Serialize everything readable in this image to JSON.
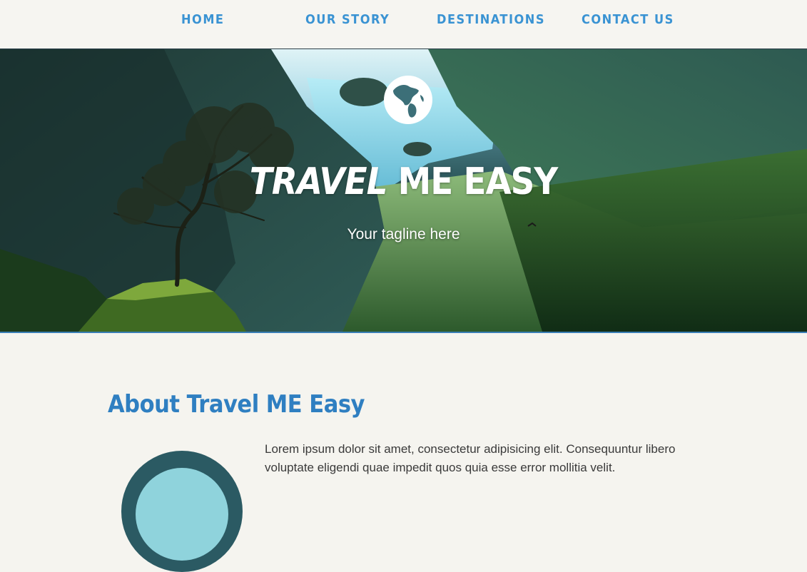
{
  "nav": {
    "items": [
      {
        "label": "HOME"
      },
      {
        "label": "OUR STORY"
      },
      {
        "label": "DESTINATIONS"
      },
      {
        "label": "CONTACT US"
      }
    ]
  },
  "hero": {
    "title_accent": "TRAVEL",
    "title_rest": " ME EASY",
    "tagline": "Your tagline here",
    "logo_icon": "globe-icon"
  },
  "about": {
    "title": "About Travel ME Easy",
    "text": "Lorem ipsum dolor sit amet, consectetur adipisicing elit. Consequuntur libero voluptate eligendi quae impedit quos quia esse error mollitia velit."
  },
  "colors": {
    "accent": "#3a93d3",
    "heading": "#2f7fc1",
    "background": "#f5f4ef"
  }
}
